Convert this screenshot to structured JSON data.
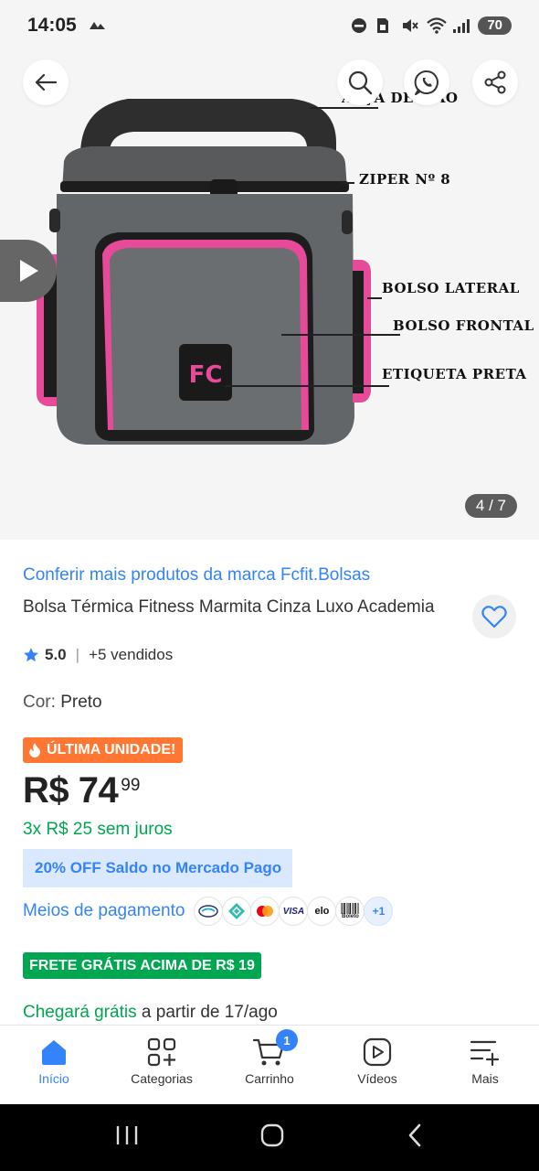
{
  "status_bar": {
    "time": "14:05",
    "battery": "70"
  },
  "gallery": {
    "counter": "4 / 7",
    "annotations": {
      "handle": "ALÇA DE MÃO",
      "zipper": "ZIPER Nº 8",
      "side_pocket": "BOLSO LATERAL",
      "front_pocket": "BOLSO FRONTAL",
      "label": "ETIQUETA PRETA"
    },
    "logo_text": "FC"
  },
  "product": {
    "brand_link": "Conferir mais produtos da marca Fcfit.Bolsas",
    "title": "Bolsa Térmica Fitness Marmita Cinza Luxo Academia",
    "rating": "5.0",
    "sold": "+5 vendidos",
    "color_label": "Cor: ",
    "color_value": "Preto",
    "badge": "ÚLTIMA UNIDADE!",
    "price_main": "R$ 74",
    "price_cents": "99",
    "installments": "3x R$ 25 sem juros",
    "promo": "20% OFF Saldo no Mercado Pago",
    "payment_label": "Meios de pagamento",
    "payment_methods": [
      "mercado-pago-icon",
      "pix-icon",
      "mastercard-icon",
      "VISA",
      "elo",
      "Boleto"
    ],
    "payment_more": "+1",
    "free_shipping": "FRETE GRÁTIS ACIMA DE R$ 19",
    "arrival_green": "Chegará grátis",
    "arrival_rest": " a partir de 17/ago"
  },
  "bottom_nav": {
    "items": [
      {
        "label": "Início",
        "icon": "home-icon"
      },
      {
        "label": "Categorias",
        "icon": "categories-icon"
      },
      {
        "label": "Carrinho",
        "icon": "cart-icon",
        "badge": "1"
      },
      {
        "label": "Vídeos",
        "icon": "video-icon"
      },
      {
        "label": "Mais",
        "icon": "more-icon"
      }
    ]
  },
  "colors": {
    "accent": "#3483fa",
    "green": "#00a650",
    "orange": "#ff7733",
    "pink": "#e84a9a"
  }
}
